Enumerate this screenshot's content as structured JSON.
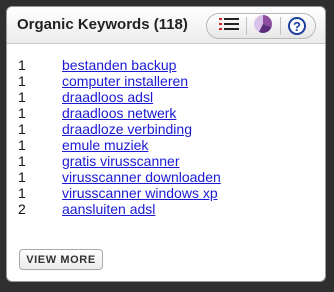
{
  "widget": {
    "title": "Organic Keywords (118)"
  },
  "toolbar": {
    "list_icon": "list-icon",
    "chart_icon": "pie-chart-icon",
    "help_icon": "help-icon",
    "help_glyph": "?",
    "colors": {
      "list": "#cc2222",
      "pie_a": "#8e4fa0",
      "pie_b": "#5a2e7a",
      "pie_c": "#d8c2ea",
      "help": "#1a3f9e"
    }
  },
  "keywords": [
    {
      "position": "1",
      "keyword": "bestanden backup"
    },
    {
      "position": "1",
      "keyword": "computer installeren"
    },
    {
      "position": "1",
      "keyword": "draadloos adsl"
    },
    {
      "position": "1",
      "keyword": "draadloos netwerk"
    },
    {
      "position": "1",
      "keyword": "draadloze verbinding"
    },
    {
      "position": "1",
      "keyword": "emule muziek"
    },
    {
      "position": "1",
      "keyword": "gratis virusscanner"
    },
    {
      "position": "1",
      "keyword": "virusscanner downloaden"
    },
    {
      "position": "1",
      "keyword": "virusscanner windows xp"
    },
    {
      "position": "2",
      "keyword": "aansluiten adsl"
    }
  ],
  "footer": {
    "view_more_label": "VIEW MORE"
  },
  "colors": {
    "link": "#1a1ad6",
    "background": "#2f2f2f"
  }
}
